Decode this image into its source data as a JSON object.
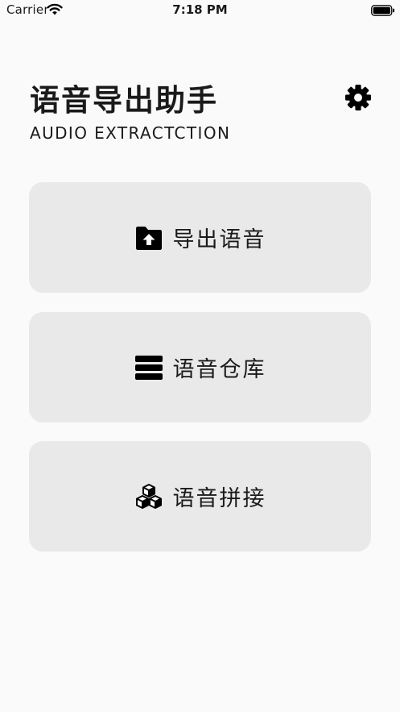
{
  "status_bar": {
    "carrier": "Carrier",
    "time": "7:18 PM",
    "icons": [
      "wifi-icon",
      "battery-icon"
    ]
  },
  "header": {
    "title": "语音导出助手",
    "subtitle": "AUDIO EXTRACTCTION",
    "settings_icon": "gear-icon"
  },
  "menu": {
    "items": [
      {
        "label": "导出语音",
        "icon": "folder-upload-icon"
      },
      {
        "label": "语音仓库",
        "icon": "storage-icon"
      },
      {
        "label": "语音拼接",
        "icon": "cubes-icon"
      }
    ]
  },
  "colors": {
    "background": "#fafafa",
    "card": "#e9e9e9",
    "text": "#1a1a1a"
  }
}
